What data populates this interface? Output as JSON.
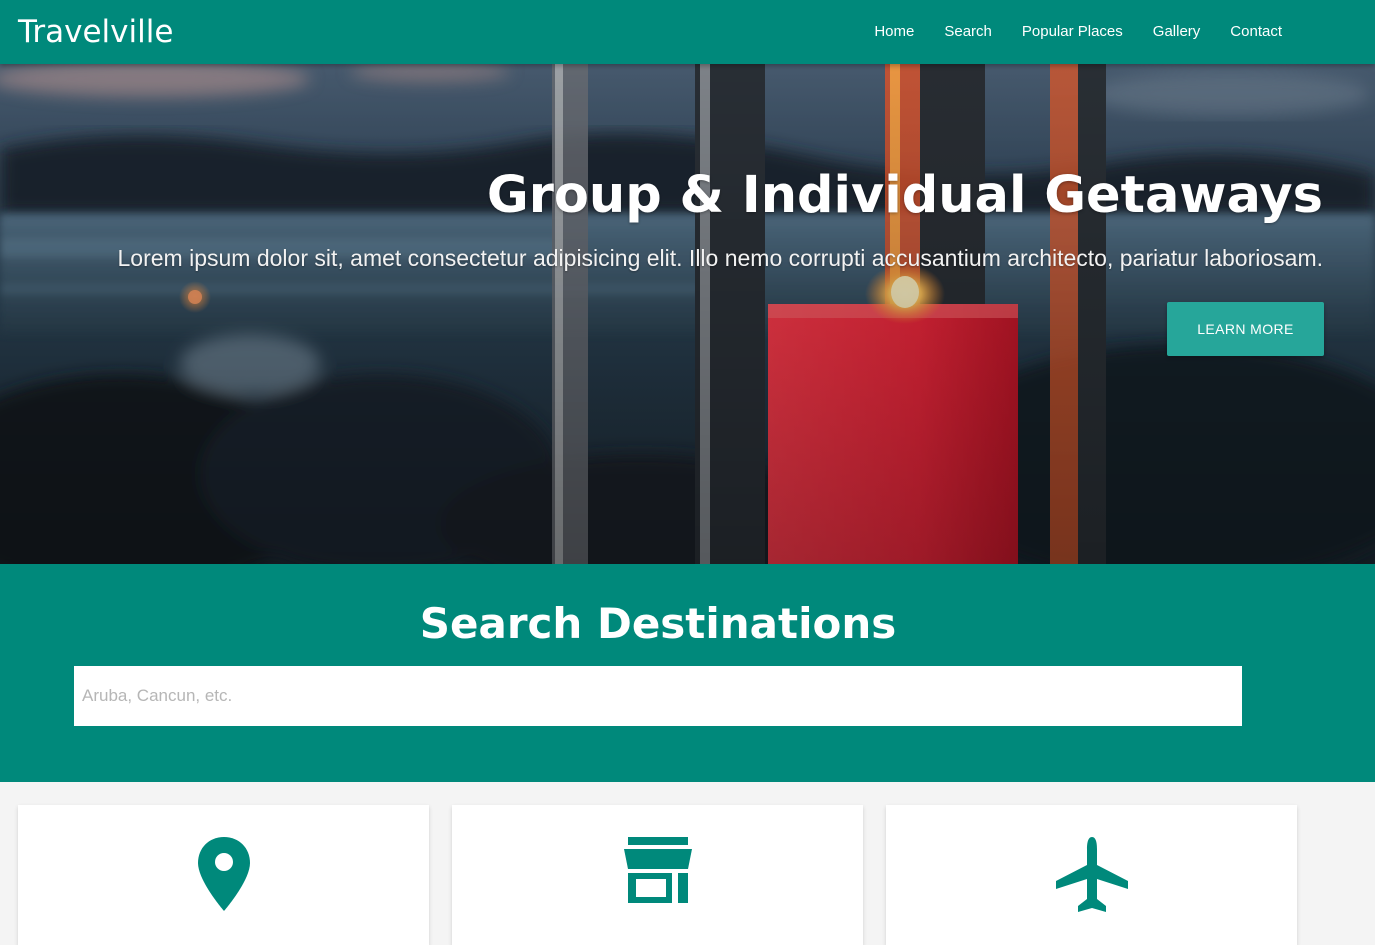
{
  "nav": {
    "brand": "Travelville",
    "links": [
      "Home",
      "Search",
      "Popular Places",
      "Gallery",
      "Contact"
    ]
  },
  "hero": {
    "title": "Group & Individual Getaways",
    "subtitle": "Lorem ipsum dolor sit, amet consectetur adipisicing elit. Illo nemo corrupti accusantium architecto, pariatur laboriosam.",
    "button_label": "LEARN MORE"
  },
  "search": {
    "title": "Search Destinations",
    "placeholder": "Aruba, Cancun, etc.",
    "value": ""
  },
  "cards": [
    {
      "icon": "map-marker-icon"
    },
    {
      "icon": "store-icon"
    },
    {
      "icon": "airplane-icon"
    }
  ],
  "colors": {
    "primary": "#00897b",
    "button": "#26a69a",
    "background": "#f4f4f4"
  }
}
